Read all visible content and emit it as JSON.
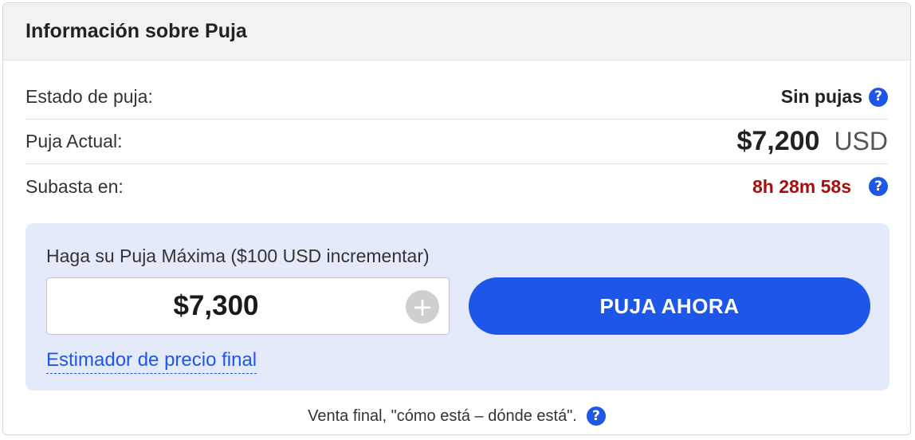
{
  "header": {
    "title": "Información sobre Puja"
  },
  "rows": {
    "status": {
      "label": "Estado de puja:",
      "value": "Sin pujas"
    },
    "current_bid": {
      "label": "Puja Actual:",
      "amount": "$7,200",
      "currency": "USD"
    },
    "auction": {
      "label": "Subasta en:",
      "countdown": "8h 28m 58s"
    }
  },
  "bid_panel": {
    "label": "Haga su Puja Máxima ($100 USD incrementar)",
    "input_value": "$7,300",
    "plus_symbol": "+",
    "button_label": "PUJA AHORA",
    "estimator_link": "Estimador de precio final"
  },
  "footer": {
    "note": "Venta final, \"cómo está – dónde está\"."
  },
  "icons": {
    "help": "?"
  },
  "colors": {
    "accent": "#1e57e8",
    "timer": "#a40f0f",
    "panel_bg": "#e5eafb"
  }
}
